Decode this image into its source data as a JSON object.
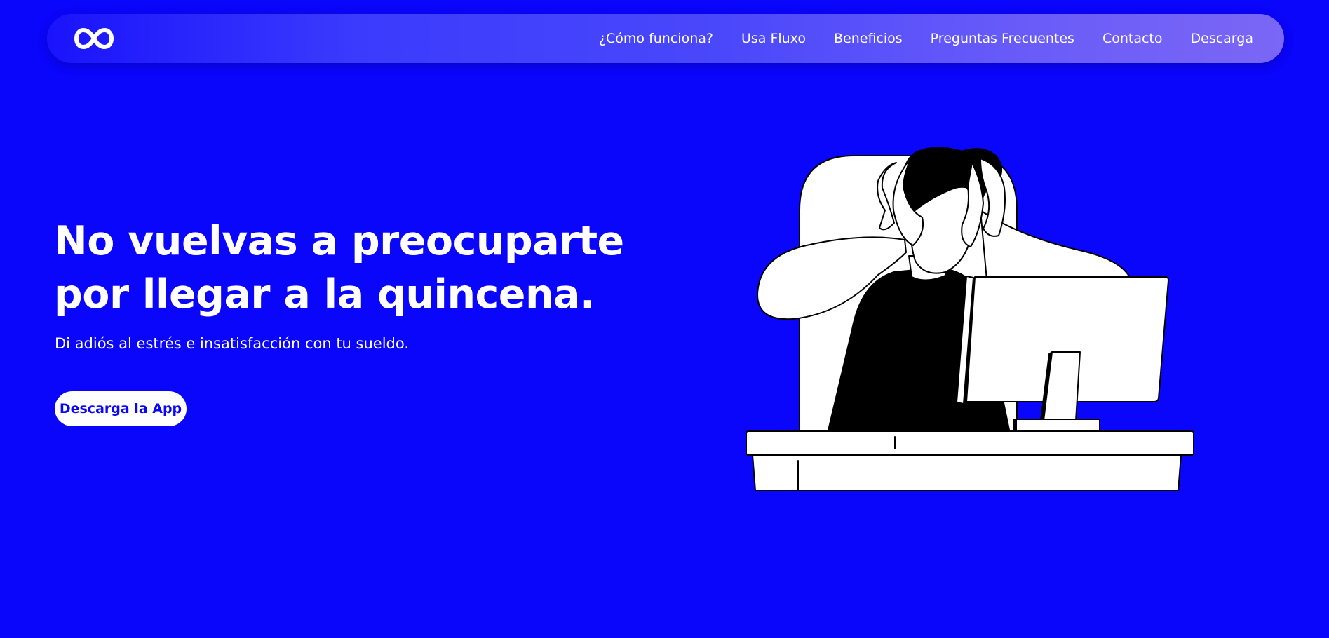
{
  "nav": {
    "logo_icon": "infinity-logo-icon",
    "links": [
      "¿Cómo funciona?",
      "Usa Fluxo",
      "Beneficios",
      "Preguntas Frecuentes",
      "Contacto",
      "Descarga"
    ]
  },
  "hero": {
    "title": "No vuelvas a preocuparte por llegar a la quincena.",
    "subtitle": "Di adiós al estrés e insatisfacción con tu sueldo.",
    "cta_label": "Descarga la App",
    "illustration_icon": "stressed-person-at-computer-illustration"
  },
  "colors": {
    "background": "#0a05fb",
    "nav_gradient_start": "#1a13fc",
    "nav_gradient_end": "#7b67f6",
    "text": "#ffffff",
    "button_bg": "#ffffff",
    "button_text": "#0a05fb"
  }
}
